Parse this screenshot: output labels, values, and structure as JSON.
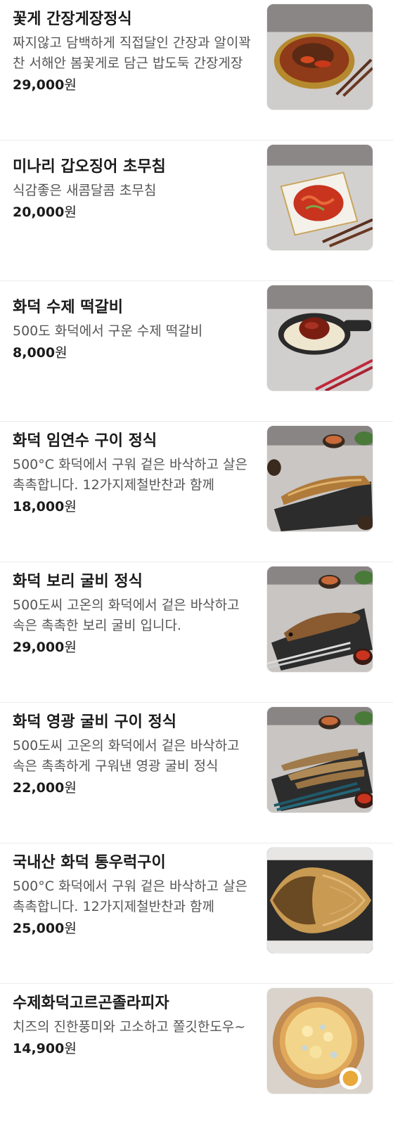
{
  "menu": {
    "currency_suffix": "원",
    "items": [
      {
        "name": "꽃게 간장게장정식",
        "description": "짜지않고 담백하게 직접달인 간장과 알이꽉찬 서해안 봄꽃게로 담근 밥도둑 간장게장",
        "price": "29,000",
        "image": "soy-crab-photo"
      },
      {
        "name": "미나리 갑오징어 초무침",
        "description": "식감좋은 새콤달콤 초무침",
        "price": "20,000",
        "image": "squid-salad-photo"
      },
      {
        "name": "화덕 수제 떡갈비",
        "description": "500도 화덕에서 구운 수제 떡갈비",
        "price": "8,000",
        "image": "tteokgalbi-photo"
      },
      {
        "name": "화덕 임연수 구이 정식",
        "description": "500°C 화덕에서 구워 겉은 바삭하고 살은 촉촉합니다. 12가지제철반찬과 함께",
        "price": "18,000",
        "image": "grilled-mackerel-photo"
      },
      {
        "name": "화덕 보리 굴비 정식",
        "description": "500도씨 고온의 화덕에서 겉은 바삭하고 속은 촉촉한 보리 굴비 입니다.",
        "price": "29,000",
        "image": "barley-gulbi-photo"
      },
      {
        "name": "화덕 영광 굴비 구이 정식",
        "description": "500도씨 고온의 화덕에서 겉은 바삭하고 속은 촉촉하게 구워낸 영광 굴비 정식",
        "price": "22,000",
        "image": "yeonggwang-gulbi-photo"
      },
      {
        "name": "국내산 화덕 통우럭구이",
        "description": "500°C 화덕에서 구워 겉은 바삭하고 살은 촉촉합니다. 12가지제철반찬과 함께",
        "price": "25,000",
        "image": "rockfish-photo"
      },
      {
        "name": "수제화덕고르곤졸라피자",
        "description": "치즈의 진한풍미와 고소하고 쫄깃한도우~",
        "price": "14,900",
        "image": "gorgonzola-pizza-photo"
      }
    ]
  }
}
